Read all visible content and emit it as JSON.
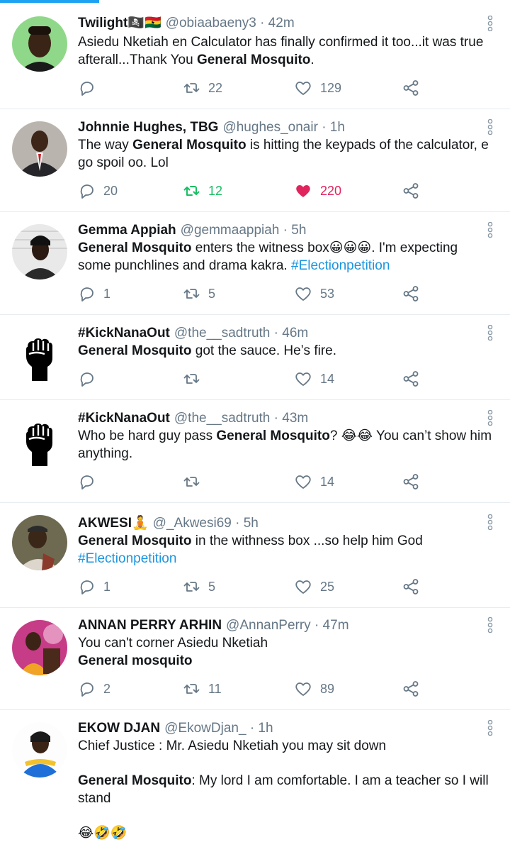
{
  "colors": {
    "accent": "#1da1f2",
    "retweet_active": "#17bf63",
    "like_active": "#e0245e",
    "muted": "#657786",
    "hashtag": "#1b95e0"
  },
  "tweets": [
    {
      "name": "Twilight🏴‍☠️🇬🇭",
      "handle": "@obiaabaeny3",
      "time": "· 42m",
      "text": [
        {
          "t": "Asiedu Nketiah en Calculator has finally confirmed it too...it was true afterall...Thank You "
        },
        {
          "t": "General Mosquito",
          "b": true
        },
        {
          "t": "."
        }
      ],
      "replies": "",
      "retweets": "22",
      "likes": "129"
    },
    {
      "name": "Johnnie Hughes, TBG",
      "handle": "@hughes_onair",
      "time": "· 1h",
      "text": [
        {
          "t": "The way "
        },
        {
          "t": "General Mosquito",
          "b": true
        },
        {
          "t": " is hitting the keypads of the calculator, e go spoil oo. Lol"
        }
      ],
      "replies": "20",
      "retweets": "12",
      "likes": "220",
      "retweeted": true,
      "liked": true
    },
    {
      "name": "Gemma Appiah",
      "handle": "@gemmaappiah",
      "time": "· 5h",
      "text": [
        {
          "t": "General Mosquito",
          "b": true
        },
        {
          "t": " enters the witness box😀😀😀. I'm expecting some  punchlines and drama kakra. "
        },
        {
          "t": "#Electionpetition",
          "h": true
        }
      ],
      "replies": "1",
      "retweets": "5",
      "likes": "53"
    },
    {
      "name": "#KickNanaOut",
      "handle": "@the__sadtruth",
      "time": "· 46m",
      "text": [
        {
          "t": "General Mosquito",
          "b": true
        },
        {
          "t": " got the sauce. He’s fire."
        }
      ],
      "replies": "",
      "retweets": "",
      "likes": "14"
    },
    {
      "name": "#KickNanaOut",
      "handle": "@the__sadtruth",
      "time": "· 43m",
      "text": [
        {
          "t": "Who be hard guy pass "
        },
        {
          "t": "General Mosquito",
          "b": true
        },
        {
          "t": "? 😂😂 You can’t show him anything."
        }
      ],
      "replies": "",
      "retweets": "",
      "likes": "14"
    },
    {
      "name": "AKWESI🧘",
      "handle": "@_Akwesi69",
      "time": "· 5h",
      "text": [
        {
          "t": "General Mosquito",
          "b": true
        },
        {
          "t": " in the withness box ...so help him God "
        },
        {
          "t": "#Electionpetition",
          "h": true
        }
      ],
      "replies": "1",
      "retweets": "5",
      "likes": "25"
    },
    {
      "name": "ANNAN PERRY ARHIN",
      "handle": "@AnnanPerry",
      "time": "· 47m",
      "text": [
        {
          "t": "You can't corner Asiedu Nketiah"
        },
        {
          "br": true
        },
        {
          "t": "General mosquito",
          "b": true
        }
      ],
      "replies": "2",
      "retweets": "11",
      "likes": "89"
    },
    {
      "name": "EKOW DJAN",
      "handle": "@EkowDjan_",
      "time": "· 1h",
      "text": [
        {
          "t": "Chief Justice : Mr. Asiedu Nketiah you may sit down"
        },
        {
          "br": true
        },
        {
          "br": true
        },
        {
          "t": "General Mosquito",
          "b": true
        },
        {
          "t": ": My lord I am comfortable. I am a teacher so I will stand"
        },
        {
          "br": true
        },
        {
          "br": true
        },
        {
          "t": "😂🤣🤣"
        }
      ],
      "replies": "",
      "retweets": "",
      "likes": ""
    }
  ]
}
